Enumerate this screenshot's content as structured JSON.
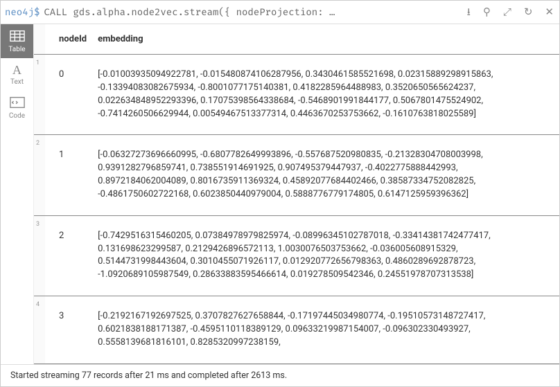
{
  "prompt": "neo4j$",
  "query": "CALL gds.alpha.node2vec.stream({ nodeProjection: …",
  "sidebar": {
    "items": [
      {
        "label": "Table",
        "icon": "table-icon",
        "active": true
      },
      {
        "label": "Text",
        "icon": "text-icon",
        "active": false
      },
      {
        "label": "Code",
        "icon": "code-icon",
        "active": false
      }
    ]
  },
  "columns": [
    "nodeId",
    "embedding"
  ],
  "rows": [
    {
      "n": "1",
      "nodeId": "0",
      "embedding": "[-0.01003935094922781, -0.015480874106287956, 0.3430461585521698, 0.02315889298915863, -0.13394083082675934, -0.8001077175140381, 0.4182285964488983, 0.3520650565624237, 0.022634848952293396, 0.17075398564338684, -0.5468901991844177, 0.5067801475524902, -0.7414260506629944, 0.00549467513377314, 0.4463670253753662, -0.1610763818025589]"
    },
    {
      "n": "2",
      "nodeId": "1",
      "embedding": "[-0.06327273696660995, -0.6807782649993896, -0.557687520980835, -0.21328304708003998, 0.9391282796859741, 0.738551914691925, 0.907495379447937, -0.4022775888442993, 0.8972184062004089, 0.8016735911369324, 0.45892077684402466, 0.38587334752082825, -0.4861750602722168, 0.6023850440979004, 0.5888776779174805, 0.6147125959396362]"
    },
    {
      "n": "3",
      "nodeId": "2",
      "embedding": "[-0.7429516315460205, 0.07384978979825974, -0.08996345102787018, -0.33414381742477417, 0.131698623299587, 0.2129426896572113, 1.0030076503753662, -0.036005608915329, 0.5144731998443604, 0.3010455071926117, 0.012920772656798363, 0.4860289692878723, -1.0920689105987549, 0.28633883595466614, 0.019278509542346, 0.24551978707313538]"
    },
    {
      "n": "4",
      "nodeId": "3",
      "embedding": "[-0.2192167192697525, 0.3707827627658844, -0.17197445034980774, -0.19510573148727417, 0.6021838188171387, -0.4595110118389129, 0.09633219987154007, -0.096302330493927, 0.5558139681816101, 0.8285320997238159,"
    }
  ],
  "footer": "Started streaming 77 records after 21 ms and completed after 2613 ms."
}
